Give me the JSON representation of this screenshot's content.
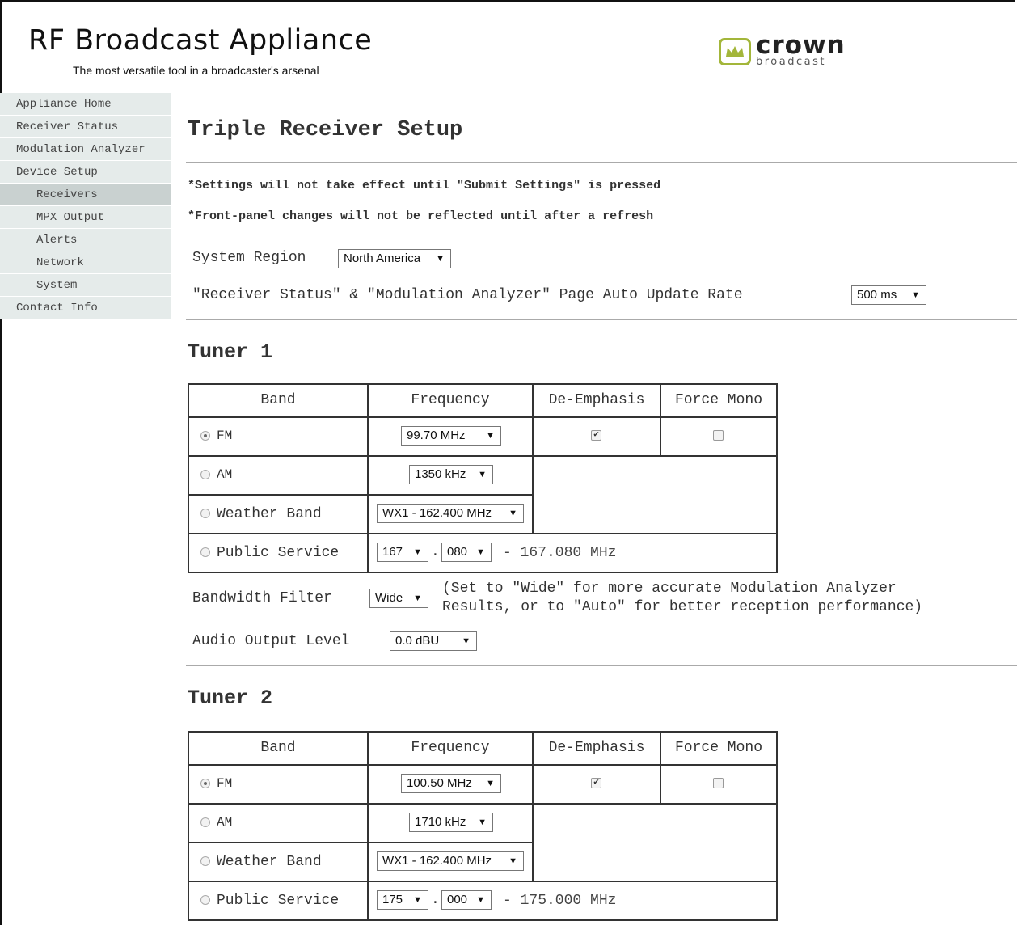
{
  "header": {
    "title": "RF Broadcast Appliance",
    "subtitle": "The most versatile tool in a broadcaster's arsenal",
    "logo_word": "crown",
    "logo_sub": "broadcast",
    "logo_color": "#a3b63a"
  },
  "sidebar": {
    "items": [
      {
        "label": "Appliance Home"
      },
      {
        "label": "Receiver Status"
      },
      {
        "label": "Modulation Analyzer"
      },
      {
        "label": "Device Setup"
      },
      {
        "label": "Receivers"
      },
      {
        "label": "MPX Output"
      },
      {
        "label": "Alerts"
      },
      {
        "label": "Network"
      },
      {
        "label": "System"
      },
      {
        "label": "Contact Info"
      }
    ],
    "active": "Receivers"
  },
  "page": {
    "title": "Triple Receiver Setup",
    "note1": "*Settings will not take effect until \"Submit Settings\" is pressed",
    "note2": "*Front-panel changes will not be reflected until after a refresh",
    "region_label": "System Region",
    "region_value": "North America",
    "update_label": "\"Receiver Status\" & \"Modulation Analyzer\" Page Auto Update Rate",
    "update_value": "500 ms"
  },
  "table_headers": {
    "band": "Band",
    "frequency": "Frequency",
    "deemphasis": "De-Emphasis",
    "force_mono": "Force Mono"
  },
  "tuner1": {
    "title": "Tuner 1",
    "fm_label": "FM",
    "fm_freq": "99.70 MHz",
    "am_label": "AM",
    "am_freq": "1350 kHz",
    "wx_label": "Weather Band",
    "wx_freq": "WX1 - 162.400 MHz",
    "ps_label": "Public Service",
    "ps_mhz": "167",
    "ps_khz": "080",
    "ps_display": "- 167.080 MHz",
    "selected_band": "FM",
    "deemphasis": true,
    "force_mono": false,
    "bw_label": "Bandwidth Filter",
    "bw_value": "Wide",
    "bw_hint1": "(Set to \"Wide\" for more accurate Modulation Analyzer",
    "bw_hint2": "Results, or to \"Auto\" for better reception performance)",
    "audio_label": "Audio Output Level",
    "audio_value": "0.0 dBU"
  },
  "tuner2": {
    "title": "Tuner 2",
    "fm_label": "FM",
    "fm_freq": "100.50 MHz",
    "am_label": "AM",
    "am_freq": "1710 kHz",
    "wx_label": "Weather Band",
    "wx_freq": "WX1 - 162.400 MHz",
    "ps_label": "Public Service",
    "ps_mhz": "175",
    "ps_khz": "000",
    "ps_display": "- 175.000 MHz",
    "selected_band": "FM",
    "deemphasis": true,
    "force_mono": false
  }
}
